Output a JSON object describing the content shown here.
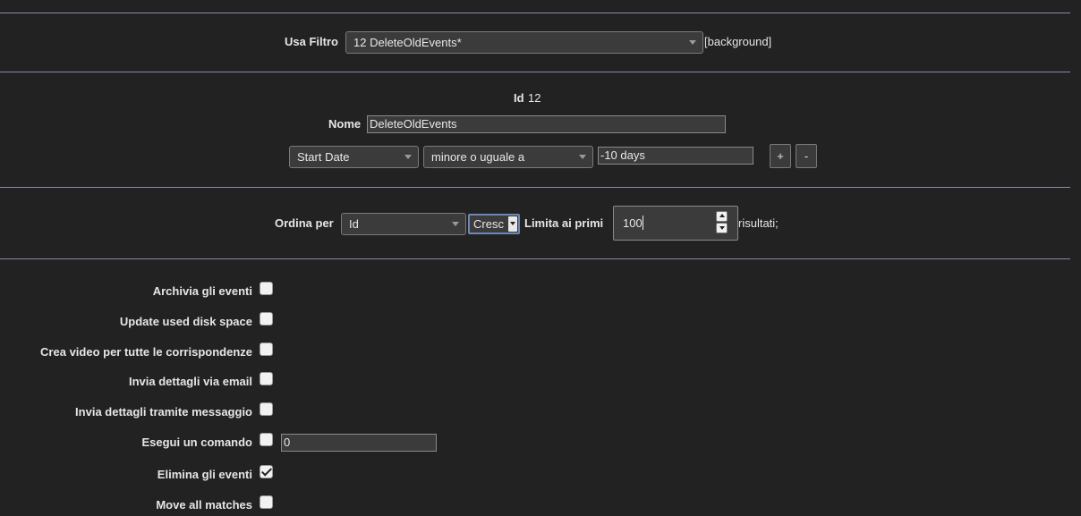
{
  "filter": {
    "label": "Usa Filtro",
    "selected": "12 DeleteOldEvents*",
    "suffix": "[background]"
  },
  "details": {
    "id_label": "Id",
    "id_value": "12",
    "name_label": "Nome",
    "name_value": "DeleteOldEvents"
  },
  "term": {
    "attr": "Start Date",
    "op": "minore o uguale a",
    "value": "-10 days",
    "add_label": "+",
    "remove_label": "-"
  },
  "sort": {
    "label": "Ordina per",
    "field": "Id",
    "direction": "Cresc",
    "limit_label": "Limita ai primi",
    "limit_value": "100",
    "results_suffix": "risultati;"
  },
  "actions": [
    {
      "label": "Archivia gli eventi",
      "checked": false
    },
    {
      "label": "Update used disk space",
      "checked": false
    },
    {
      "label": "Crea video per tutte le corrispondenze",
      "checked": false
    },
    {
      "label": "Invia dettagli via email",
      "checked": false
    },
    {
      "label": "Invia dettagli tramite messaggio",
      "checked": false
    },
    {
      "label": "Esegui un comando",
      "checked": false
    },
    {
      "label": "Elimina gli eventi",
      "checked": true
    },
    {
      "label": "Move all matches",
      "checked": false
    }
  ],
  "command_value": "0"
}
